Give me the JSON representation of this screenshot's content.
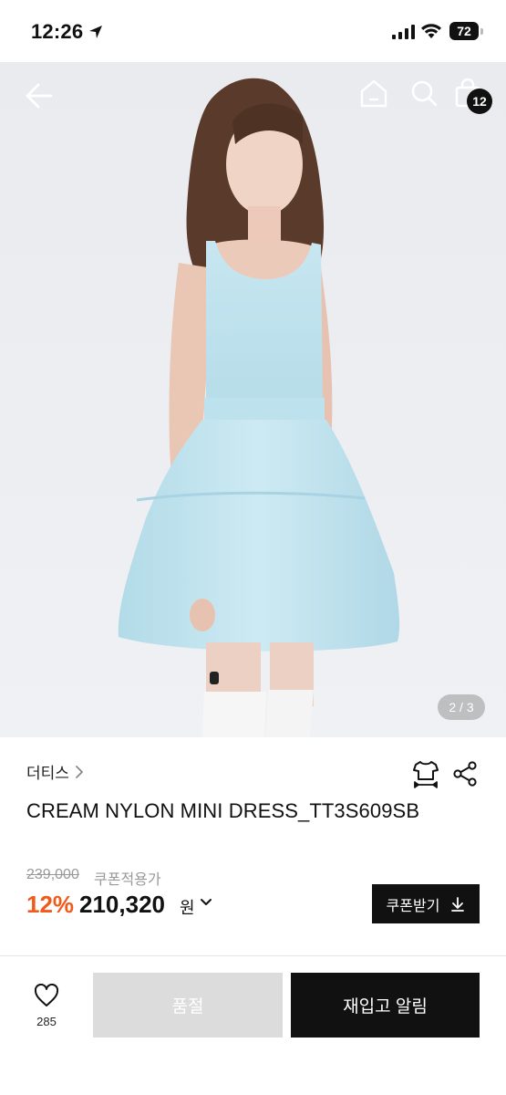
{
  "status_bar": {
    "time": "12:26",
    "battery": "72"
  },
  "header": {
    "cart_count": "12"
  },
  "gallery": {
    "indicator": "2 / 3"
  },
  "product": {
    "brand": "더티스",
    "title": "CREAM NYLON MINI DRESS_TT3S609SB",
    "original_price": "239,000",
    "coupon_price_label": "쿠폰적용가",
    "discount": "12%",
    "price": "210,320",
    "currency": "원"
  },
  "actions": {
    "coupon_label": "쿠폰받기",
    "like_count": "285",
    "soldout_label": "품절",
    "restock_label": "재입고 알림"
  },
  "colors": {
    "accent_discount": "#f05a1a",
    "dress": "#bfe3ef",
    "button_dark": "#111111",
    "button_disabled": "#dcdcdc"
  },
  "icons": [
    "location-arrow-icon",
    "signal-icon",
    "wifi-icon",
    "battery-icon",
    "back-arrow-icon",
    "home-icon",
    "search-icon",
    "shopping-bag-icon",
    "size-guide-icon",
    "share-icon",
    "chevron-right-icon",
    "chevron-down-icon",
    "download-icon",
    "heart-icon"
  ]
}
